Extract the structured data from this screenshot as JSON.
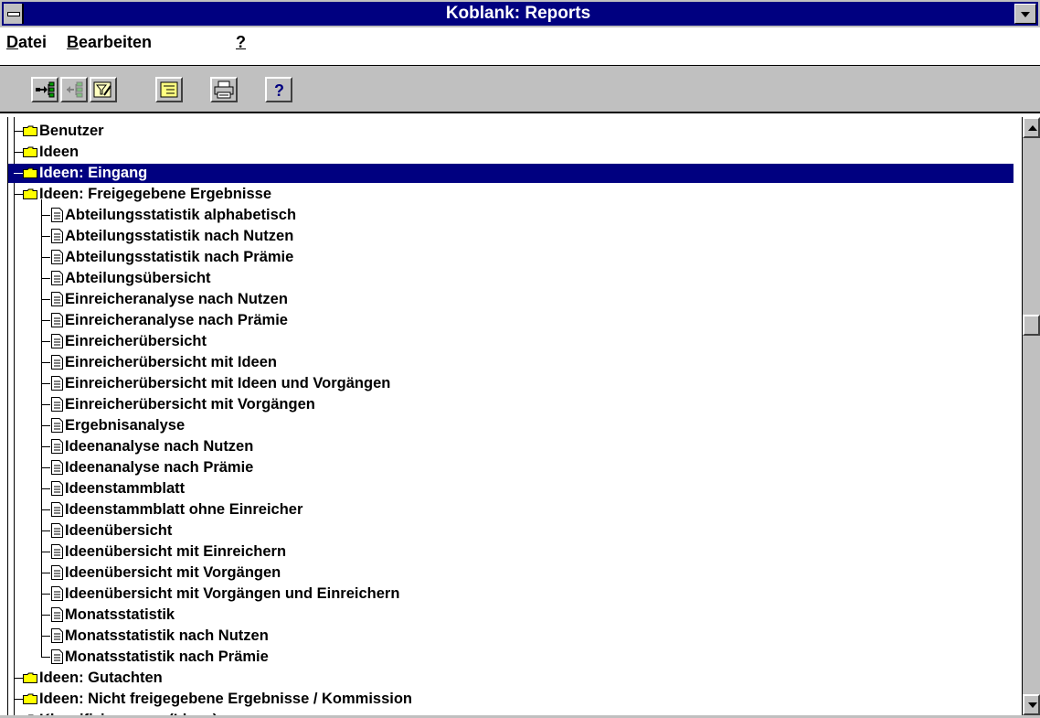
{
  "window": {
    "title": "Koblank: Reports"
  },
  "menu": [
    {
      "accel": "D",
      "rest": "atei"
    },
    {
      "accel": "B",
      "rest": "earbeiten"
    },
    {
      "accel": "?",
      "rest": ""
    }
  ],
  "toolbar": {
    "buttons": [
      {
        "icon": "expand-tree-icon",
        "enabled": true
      },
      {
        "icon": "collapse-tree-icon",
        "enabled": false
      },
      {
        "icon": "filter-icon",
        "enabled": true
      },
      {
        "icon": "list-view-icon",
        "enabled": true
      },
      {
        "icon": "printer-icon",
        "enabled": true
      },
      {
        "icon": "help-icon",
        "enabled": true
      }
    ]
  },
  "tree": {
    "folders": [
      {
        "label": "Benutzer"
      },
      {
        "label": "Ideen"
      },
      {
        "label": "Ideen: Eingang",
        "selected": true
      },
      {
        "label": "Ideen: Freigegebene Ergebnisse",
        "expanded": true,
        "children": [
          "Abteilungsstatistik alphabetisch",
          "Abteilungsstatistik nach Nutzen",
          "Abteilungsstatistik nach Prämie",
          "Abteilungsübersicht",
          "Einreicheranalyse nach Nutzen",
          "Einreicheranalyse nach Prämie",
          "Einreicherübersicht",
          "Einreicherübersicht mit Ideen",
          "Einreicherübersicht mit Ideen und Vorgängen",
          "Einreicherübersicht mit Vorgängen",
          "Ergebnisanalyse",
          "Ideenanalyse nach Nutzen",
          "Ideenanalyse nach Prämie",
          "Ideenstammblatt",
          "Ideenstammblatt ohne Einreicher",
          "Ideenübersicht",
          "Ideenübersicht mit Einreichern",
          "Ideenübersicht mit Vorgängen",
          "Ideenübersicht mit Vorgängen und Einreichern",
          "Monatsstatistik",
          "Monatsstatistik nach Nutzen",
          "Monatsstatistik nach Prämie"
        ]
      },
      {
        "label": "Ideen: Gutachten"
      },
      {
        "label": "Ideen: Nicht freigegebene Ergebnisse / Kommission"
      },
      {
        "label": "Klassifizierungen (Ideen)"
      }
    ]
  },
  "scrollbar": {
    "position": 0.33
  }
}
